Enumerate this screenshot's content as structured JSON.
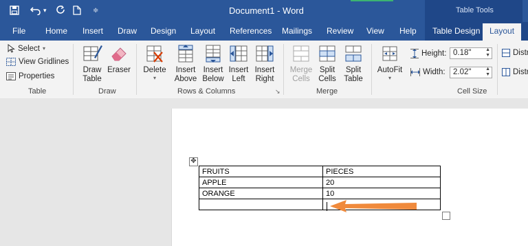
{
  "window": {
    "title": "Document1  -  Word",
    "context_group": "Table Tools"
  },
  "tabs": [
    {
      "label": "File"
    },
    {
      "label": "Home"
    },
    {
      "label": "Insert"
    },
    {
      "label": "Draw"
    },
    {
      "label": "Design"
    },
    {
      "label": "Layout"
    },
    {
      "label": "References"
    },
    {
      "label": "Mailings"
    },
    {
      "label": "Review"
    },
    {
      "label": "View"
    },
    {
      "label": "Help"
    },
    {
      "label": "Table Design"
    },
    {
      "label": "Layout"
    }
  ],
  "ribbon": {
    "table_group": {
      "label": "Table",
      "select": "Select",
      "view_gridlines": "View Gridlines",
      "properties": "Properties"
    },
    "draw_group": {
      "label": "Draw",
      "draw_table": "Draw\nTable",
      "eraser": "Eraser"
    },
    "rows_columns_group": {
      "label": "Rows & Columns",
      "delete": "Delete",
      "insert_above": "Insert\nAbove",
      "insert_below": "Insert\nBelow",
      "insert_left": "Insert\nLeft",
      "insert_right": "Insert\nRight"
    },
    "merge_group": {
      "label": "Merge",
      "merge_cells": "Merge\nCells",
      "split_cells": "Split\nCells",
      "split_table": "Split\nTable"
    },
    "cell_size_group": {
      "label": "Cell Size",
      "autofit": "AutoFit",
      "height_label": "Height:",
      "height_value": "0.18\"",
      "width_label": "Width:",
      "width_value": "2.02\"",
      "distribute_1": "Distr",
      "distribute_2": "Distr"
    }
  },
  "document": {
    "table": {
      "rows": [
        [
          "FRUITS",
          "PIECES"
        ],
        [
          "APPLE",
          "20"
        ],
        [
          "ORANGE",
          "10"
        ],
        [
          "",
          ""
        ]
      ]
    }
  },
  "colors": {
    "word_blue": "#2b579a",
    "context_blue": "#1f4788",
    "arrow_orange": "#f08a3c"
  }
}
